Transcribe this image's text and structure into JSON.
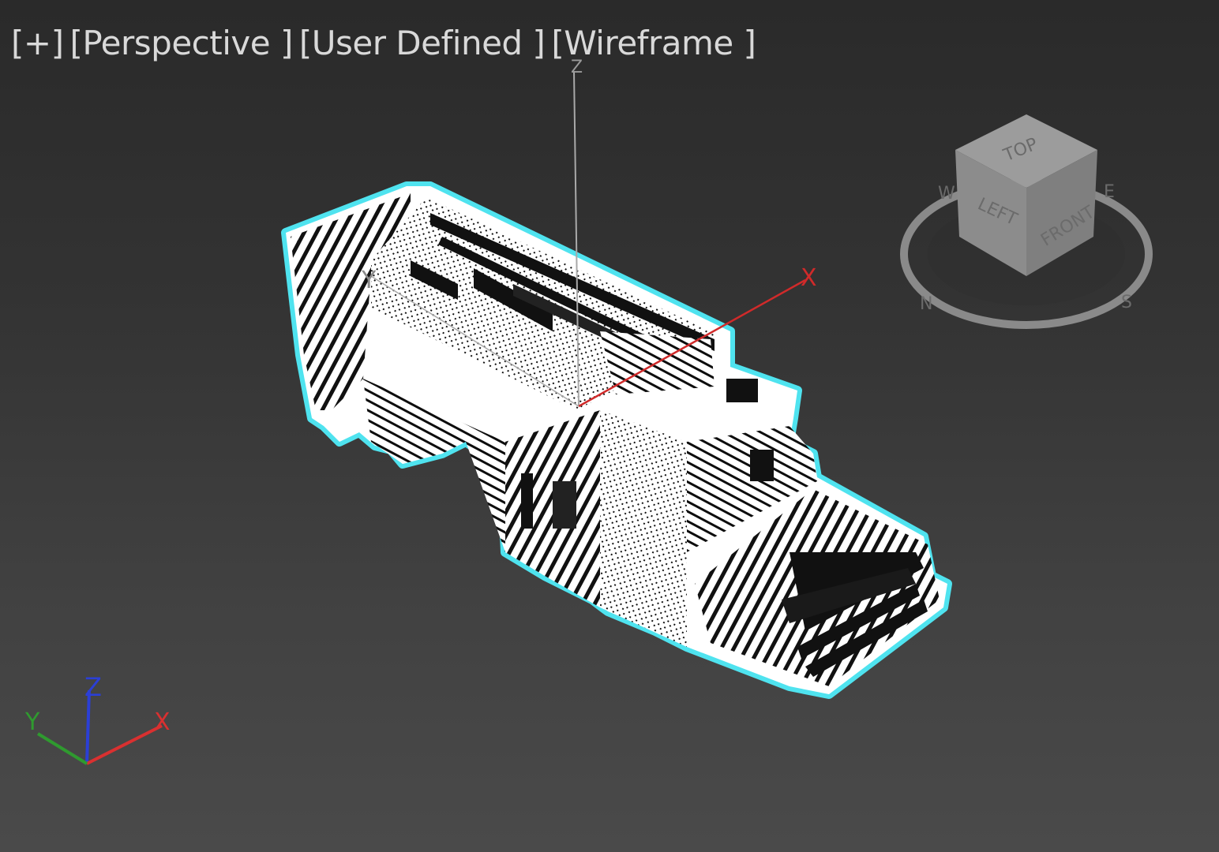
{
  "viewport": {
    "labels": [
      {
        "text": "[+]"
      },
      {
        "text": "[Perspective ]"
      },
      {
        "text": "[User Defined ]"
      },
      {
        "text": "[Wireframe ]"
      }
    ],
    "shading_mode": "Wireframe",
    "projection": "Perspective",
    "selection_color": "#4fe3ef",
    "wire_color": "#ffffff",
    "background_top": "#2a2a2a",
    "background_bottom": "#4a4a4a"
  },
  "gizmo": {
    "x_label": "X",
    "y_label": "Y",
    "z_label": "Z",
    "x_color": "#d02a2a",
    "y_color": "#9a9a9a",
    "z_color": "#9a9a9a"
  },
  "viewcube": {
    "top": "TOP",
    "left": "LEFT",
    "front": "FRONT",
    "compass": [
      "W",
      "S",
      "E",
      "N"
    ]
  },
  "world_axes": {
    "x_label": "X",
    "y_label": "Y",
    "z_label": "Z",
    "x_color": "#d93030",
    "y_color": "#2f9a2f",
    "z_color": "#2b3fd6"
  }
}
